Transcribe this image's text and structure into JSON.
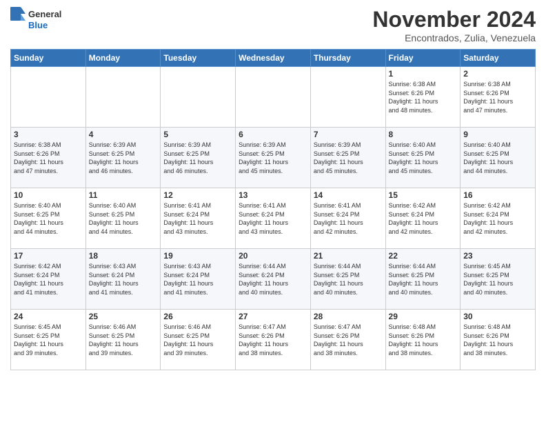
{
  "logo": {
    "general": "General",
    "blue": "Blue"
  },
  "header": {
    "title": "November 2024",
    "location": "Encontrados, Zulia, Venezuela"
  },
  "days_of_week": [
    "Sunday",
    "Monday",
    "Tuesday",
    "Wednesday",
    "Thursday",
    "Friday",
    "Saturday"
  ],
  "weeks": [
    [
      {
        "day": "",
        "info": ""
      },
      {
        "day": "",
        "info": ""
      },
      {
        "day": "",
        "info": ""
      },
      {
        "day": "",
        "info": ""
      },
      {
        "day": "",
        "info": ""
      },
      {
        "day": "1",
        "info": "Sunrise: 6:38 AM\nSunset: 6:26 PM\nDaylight: 11 hours\nand 48 minutes."
      },
      {
        "day": "2",
        "info": "Sunrise: 6:38 AM\nSunset: 6:26 PM\nDaylight: 11 hours\nand 47 minutes."
      }
    ],
    [
      {
        "day": "3",
        "info": "Sunrise: 6:38 AM\nSunset: 6:26 PM\nDaylight: 11 hours\nand 47 minutes."
      },
      {
        "day": "4",
        "info": "Sunrise: 6:39 AM\nSunset: 6:25 PM\nDaylight: 11 hours\nand 46 minutes."
      },
      {
        "day": "5",
        "info": "Sunrise: 6:39 AM\nSunset: 6:25 PM\nDaylight: 11 hours\nand 46 minutes."
      },
      {
        "day": "6",
        "info": "Sunrise: 6:39 AM\nSunset: 6:25 PM\nDaylight: 11 hours\nand 45 minutes."
      },
      {
        "day": "7",
        "info": "Sunrise: 6:39 AM\nSunset: 6:25 PM\nDaylight: 11 hours\nand 45 minutes."
      },
      {
        "day": "8",
        "info": "Sunrise: 6:40 AM\nSunset: 6:25 PM\nDaylight: 11 hours\nand 45 minutes."
      },
      {
        "day": "9",
        "info": "Sunrise: 6:40 AM\nSunset: 6:25 PM\nDaylight: 11 hours\nand 44 minutes."
      }
    ],
    [
      {
        "day": "10",
        "info": "Sunrise: 6:40 AM\nSunset: 6:25 PM\nDaylight: 11 hours\nand 44 minutes."
      },
      {
        "day": "11",
        "info": "Sunrise: 6:40 AM\nSunset: 6:25 PM\nDaylight: 11 hours\nand 44 minutes."
      },
      {
        "day": "12",
        "info": "Sunrise: 6:41 AM\nSunset: 6:24 PM\nDaylight: 11 hours\nand 43 minutes."
      },
      {
        "day": "13",
        "info": "Sunrise: 6:41 AM\nSunset: 6:24 PM\nDaylight: 11 hours\nand 43 minutes."
      },
      {
        "day": "14",
        "info": "Sunrise: 6:41 AM\nSunset: 6:24 PM\nDaylight: 11 hours\nand 42 minutes."
      },
      {
        "day": "15",
        "info": "Sunrise: 6:42 AM\nSunset: 6:24 PM\nDaylight: 11 hours\nand 42 minutes."
      },
      {
        "day": "16",
        "info": "Sunrise: 6:42 AM\nSunset: 6:24 PM\nDaylight: 11 hours\nand 42 minutes."
      }
    ],
    [
      {
        "day": "17",
        "info": "Sunrise: 6:42 AM\nSunset: 6:24 PM\nDaylight: 11 hours\nand 41 minutes."
      },
      {
        "day": "18",
        "info": "Sunrise: 6:43 AM\nSunset: 6:24 PM\nDaylight: 11 hours\nand 41 minutes."
      },
      {
        "day": "19",
        "info": "Sunrise: 6:43 AM\nSunset: 6:24 PM\nDaylight: 11 hours\nand 41 minutes."
      },
      {
        "day": "20",
        "info": "Sunrise: 6:44 AM\nSunset: 6:24 PM\nDaylight: 11 hours\nand 40 minutes."
      },
      {
        "day": "21",
        "info": "Sunrise: 6:44 AM\nSunset: 6:25 PM\nDaylight: 11 hours\nand 40 minutes."
      },
      {
        "day": "22",
        "info": "Sunrise: 6:44 AM\nSunset: 6:25 PM\nDaylight: 11 hours\nand 40 minutes."
      },
      {
        "day": "23",
        "info": "Sunrise: 6:45 AM\nSunset: 6:25 PM\nDaylight: 11 hours\nand 40 minutes."
      }
    ],
    [
      {
        "day": "24",
        "info": "Sunrise: 6:45 AM\nSunset: 6:25 PM\nDaylight: 11 hours\nand 39 minutes."
      },
      {
        "day": "25",
        "info": "Sunrise: 6:46 AM\nSunset: 6:25 PM\nDaylight: 11 hours\nand 39 minutes."
      },
      {
        "day": "26",
        "info": "Sunrise: 6:46 AM\nSunset: 6:25 PM\nDaylight: 11 hours\nand 39 minutes."
      },
      {
        "day": "27",
        "info": "Sunrise: 6:47 AM\nSunset: 6:26 PM\nDaylight: 11 hours\nand 38 minutes."
      },
      {
        "day": "28",
        "info": "Sunrise: 6:47 AM\nSunset: 6:26 PM\nDaylight: 11 hours\nand 38 minutes."
      },
      {
        "day": "29",
        "info": "Sunrise: 6:48 AM\nSunset: 6:26 PM\nDaylight: 11 hours\nand 38 minutes."
      },
      {
        "day": "30",
        "info": "Sunrise: 6:48 AM\nSunset: 6:26 PM\nDaylight: 11 hours\nand 38 minutes."
      }
    ]
  ]
}
